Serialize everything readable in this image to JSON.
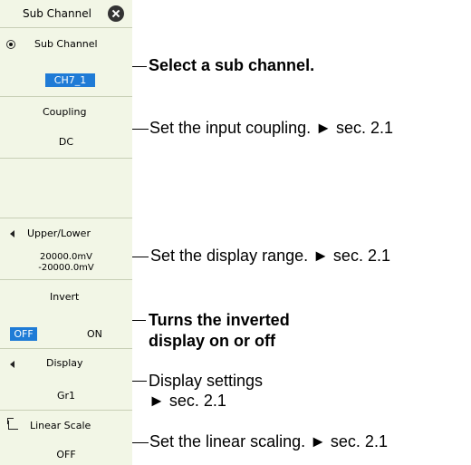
{
  "menu": {
    "title": "Sub Channel",
    "sub_channel": {
      "label": "Sub Channel",
      "value": "CH7_1"
    },
    "coupling": {
      "label": "Coupling",
      "value": "DC"
    },
    "upper_lower": {
      "label": "Upper/Lower",
      "upper": "20000.0mV",
      "lower": "-20000.0mV"
    },
    "invert": {
      "label": "Invert",
      "off": "OFF",
      "on": "ON",
      "selected": "OFF"
    },
    "display": {
      "label": "Display",
      "value": "Gr1"
    },
    "linear_scale": {
      "label": "Linear Scale",
      "value": "OFF"
    }
  },
  "annotations": {
    "sub_channel": "Select a sub channel.",
    "coupling": "Set the input coupling. ► sec. 2.1",
    "display_range": "Set the display range. ► sec. 2.1",
    "invert_line1": "Turns the inverted",
    "invert_line2": "display on or off",
    "display_line1": "Display settings",
    "display_line2": "► sec. 2.1",
    "linear_scaling": "Set the linear scaling. ► sec. 2.1"
  },
  "colors": {
    "panel_bg": "#f2f6e6",
    "highlight": "#1f7bd6"
  }
}
